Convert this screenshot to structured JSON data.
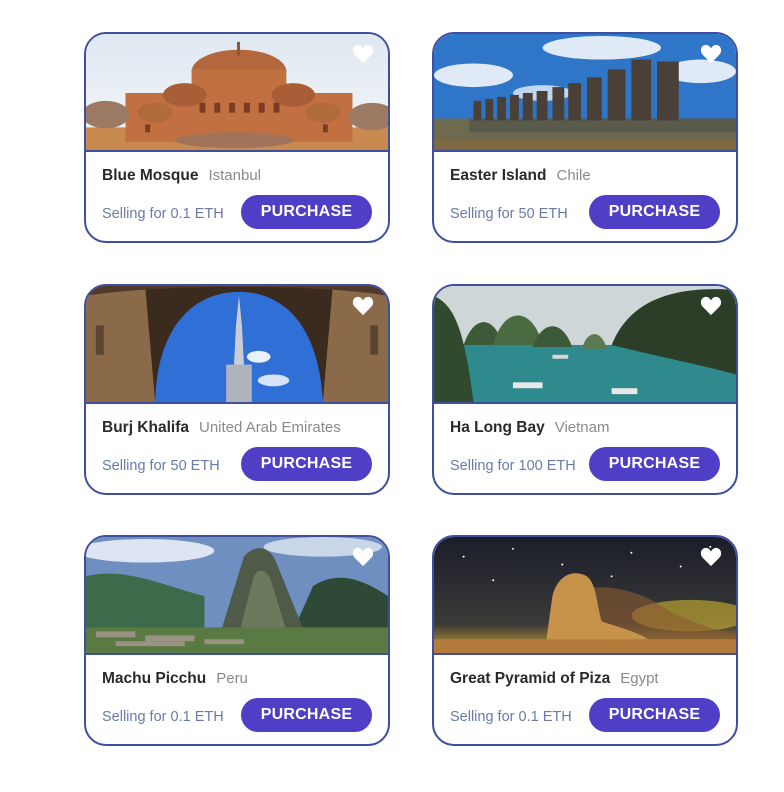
{
  "cards": [
    {
      "name": "Blue Mosque",
      "location": "Istanbul",
      "price": "Selling for 0.1 ETH",
      "button": "PURCHASE",
      "image_icon": "mosque-photo",
      "favorite_icon": "heart-icon"
    },
    {
      "name": "Easter Island",
      "location": "Chile",
      "price": "Selling for 50 ETH",
      "button": "PURCHASE",
      "image_icon": "moai-photo",
      "favorite_icon": "heart-icon"
    },
    {
      "name": "Burj Khalifa",
      "location": "United Arab Emirates",
      "price": "Selling for 50 ETH",
      "button": "PURCHASE",
      "image_icon": "tower-photo",
      "favorite_icon": "heart-icon"
    },
    {
      "name": "Ha Long Bay",
      "location": "Vietnam",
      "price": "Selling for 100 ETH",
      "button": "PURCHASE",
      "image_icon": "bay-photo",
      "favorite_icon": "heart-icon"
    },
    {
      "name": "Machu Picchu",
      "location": "Peru",
      "price": "Selling for 0.1 ETH",
      "button": "PURCHASE",
      "image_icon": "mountain-ruins-photo",
      "favorite_icon": "heart-icon"
    },
    {
      "name": "Great Pyramid of Piza",
      "location": "Egypt",
      "price": "Selling for 0.1 ETH",
      "button": "PURCHASE",
      "image_icon": "sphinx-photo",
      "favorite_icon": "heart-icon"
    }
  ],
  "colors": {
    "accent": "#4f3fc6",
    "border": "#3f4fa0",
    "price_text": "#6b7aa8",
    "location_text": "#8a8a8a"
  }
}
